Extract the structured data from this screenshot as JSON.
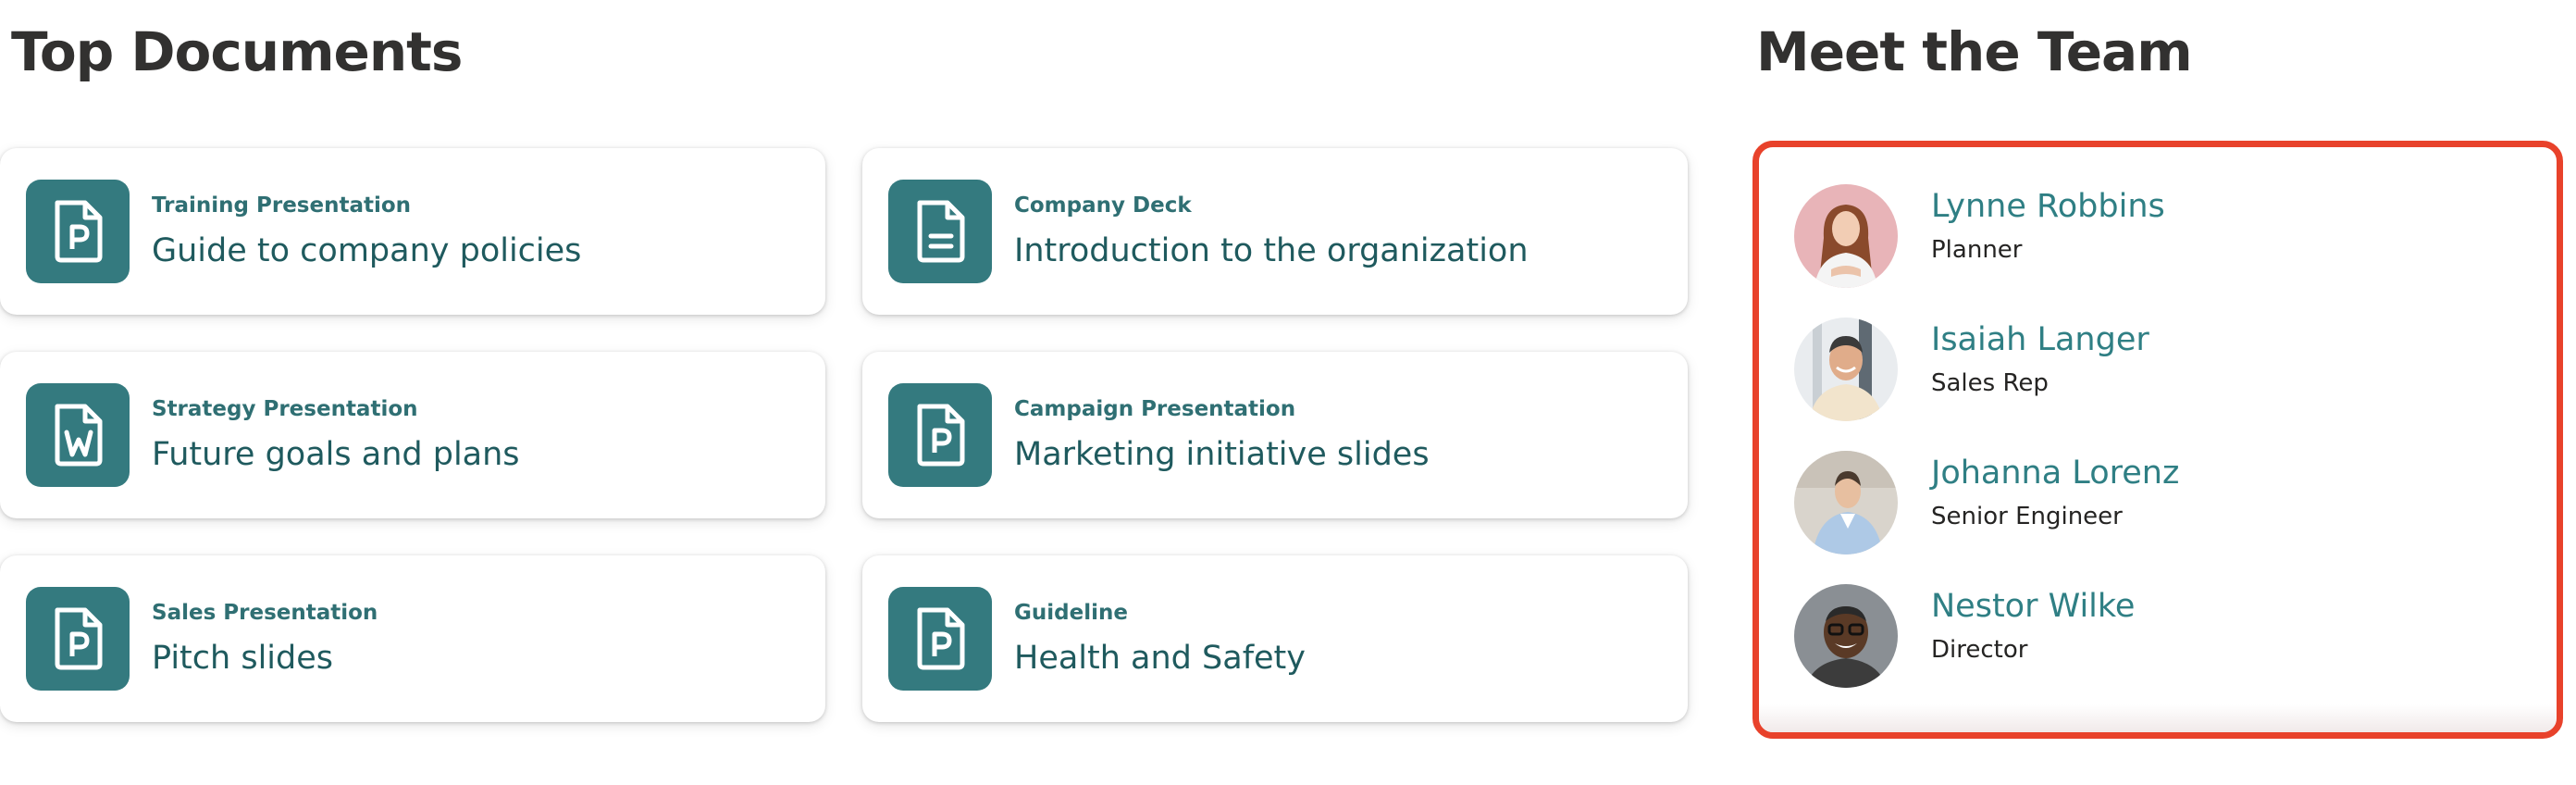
{
  "documents": {
    "title": "Top Documents",
    "cards": [
      {
        "type": "Training Presentation",
        "description": "Guide to company policies",
        "icon": "powerpoint-file-icon"
      },
      {
        "type": "Company Deck",
        "description": "Introduction to the organization",
        "icon": "document-file-icon"
      },
      {
        "type": "Strategy Presentation",
        "description": "Future goals and plans",
        "icon": "word-file-icon"
      },
      {
        "type": "Campaign Presentation",
        "description": "Marketing initiative slides",
        "icon": "powerpoint-file-icon"
      },
      {
        "type": "Sales Presentation",
        "description": "Pitch slides",
        "icon": "powerpoint-file-icon"
      },
      {
        "type": "Guideline",
        "description": "Health and Safety",
        "icon": "powerpoint-file-icon"
      }
    ]
  },
  "team": {
    "title": "Meet the Team",
    "members": [
      {
        "name": "Lynne Robbins",
        "role": "Planner"
      },
      {
        "name": "Isaiah Langer",
        "role": "Sales Rep"
      },
      {
        "name": "Johanna Lorenz",
        "role": "Senior Engineer"
      },
      {
        "name": "Nestor Wilke",
        "role": "Director"
      }
    ]
  },
  "colors": {
    "accent": "#347a7f",
    "name_text": "#2f7f84",
    "highlight_border": "#e8422b"
  }
}
